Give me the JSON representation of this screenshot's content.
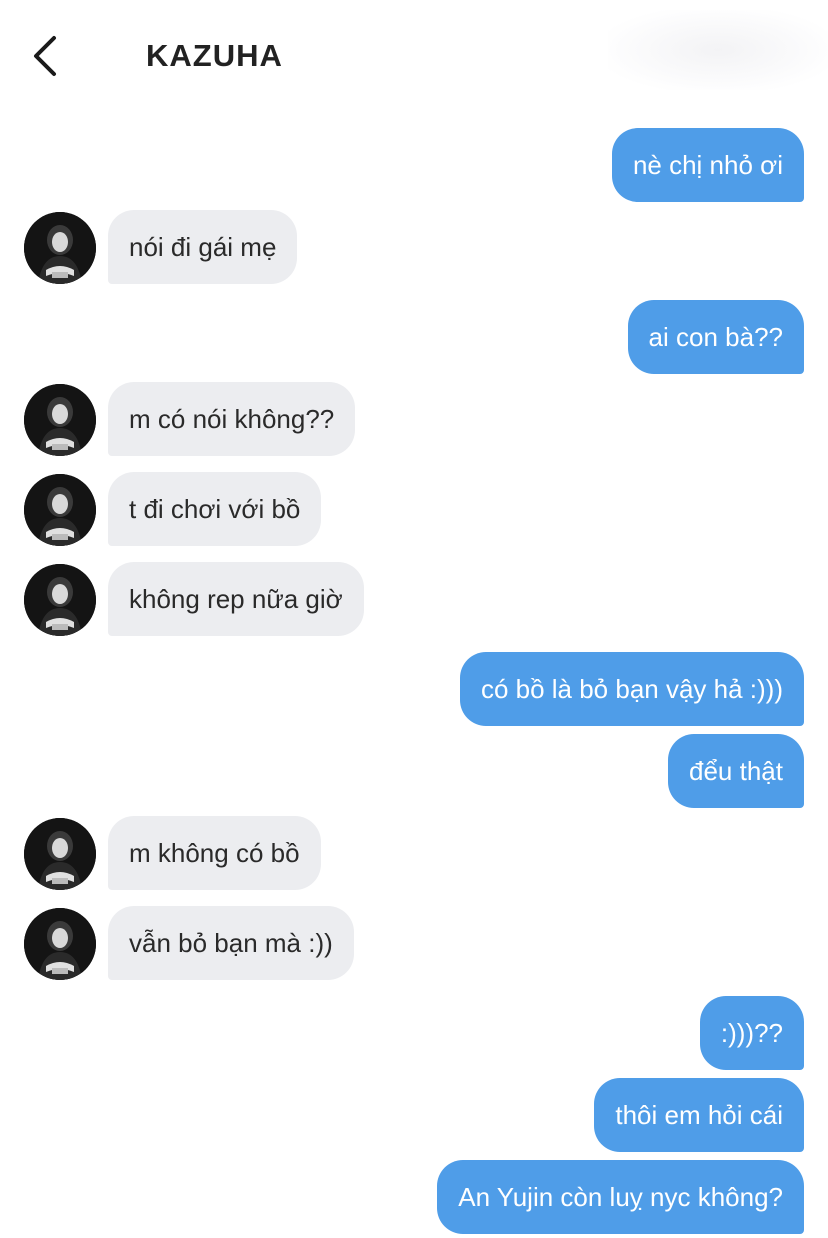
{
  "header": {
    "title": "KAZUHA",
    "back_icon": "chevron-left-icon"
  },
  "colors": {
    "outgoing_bubble": "#4f9de8",
    "incoming_bubble": "#ecedf0",
    "outgoing_text": "#ffffff",
    "incoming_text": "#2a2a2a"
  },
  "messages": [
    {
      "direction": "out",
      "text": "nè chị nhỏ ơi"
    },
    {
      "direction": "in",
      "text": "nói đi gái mẹ"
    },
    {
      "direction": "out",
      "text": "ai con bà??"
    },
    {
      "direction": "in",
      "text": "m có nói không??"
    },
    {
      "direction": "in",
      "text": "t đi chơi với bồ"
    },
    {
      "direction": "in",
      "text": "không rep nữa giờ"
    },
    {
      "direction": "out",
      "text": "có bồ là bỏ bạn vậy hả :)))"
    },
    {
      "direction": "out",
      "text": "đểu thật"
    },
    {
      "direction": "in",
      "text": "m không có bồ"
    },
    {
      "direction": "in",
      "text": "vẫn bỏ bạn mà :))"
    },
    {
      "direction": "out",
      "text": ":)))??"
    },
    {
      "direction": "out",
      "text": "thôi em hỏi cái"
    },
    {
      "direction": "out",
      "text": "An Yujin còn luỵ nyc không?"
    }
  ]
}
